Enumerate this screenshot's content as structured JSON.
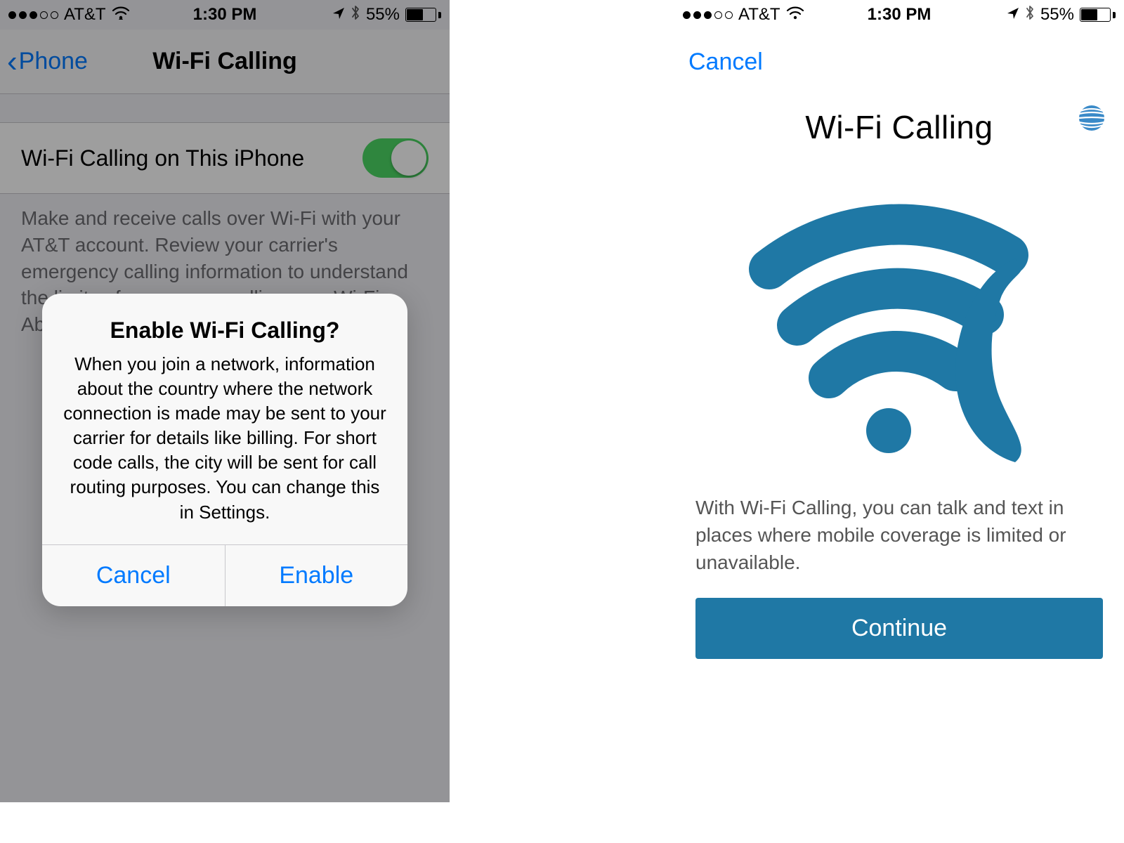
{
  "left": {
    "status": {
      "carrier": "AT&T",
      "time": "1:30 PM",
      "battery_pct": "55%"
    },
    "nav": {
      "back": "Phone",
      "title": "Wi-Fi Calling"
    },
    "toggle": {
      "label": "Wi-Fi Calling on This iPhone",
      "on": true
    },
    "footer": "Make and receive calls over Wi-Fi with your AT&T account. Review your carrier's emergency calling information to understand the limits of emergency calling over Wi-Fi. About Wi-Fi Calling & Privacy...",
    "alert": {
      "title": "Enable Wi-Fi Calling?",
      "message": "When you join a network, information about the country where the network connection is made may be sent to your carrier for details like billing. For short code calls, the city will be sent for call routing purposes. You can change this in Settings.",
      "cancel": "Cancel",
      "confirm": "Enable"
    }
  },
  "right": {
    "status": {
      "carrier": "AT&T",
      "time": "1:30 PM",
      "battery_pct": "55%"
    },
    "cancel": "Cancel",
    "title": "Wi-Fi Calling",
    "body": "With Wi-Fi Calling, you can talk and text in places where mobile coverage is limited or unavailable.",
    "continue": "Continue"
  }
}
